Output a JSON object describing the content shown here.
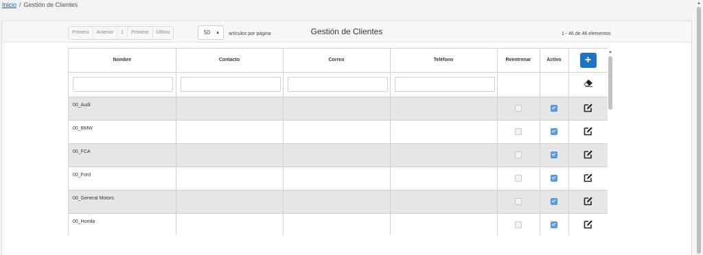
{
  "breadcrumb": {
    "home": "Inicio",
    "separator": "/",
    "current": "Gestión de Clientes"
  },
  "panel": {
    "title": "Gestión de Clientes"
  },
  "pager": {
    "first": "Primero",
    "previous": "Anterior",
    "page": "1",
    "next": "Próximo",
    "last": "Último"
  },
  "per_page": {
    "value": "50",
    "label": "artículos por página"
  },
  "range_text": "1 - 46 de 46 elementos",
  "columns": {
    "name": "Nombre",
    "contact": "Contacto",
    "email": "Correo",
    "phone": "Teléfono",
    "retrain": "Reentrenar",
    "active": "Activo",
    "add": "+"
  },
  "rows": [
    {
      "name": "00_Audi",
      "retrain": false,
      "active": true
    },
    {
      "name": "00_BMW",
      "retrain": false,
      "active": true
    },
    {
      "name": "00_FCA",
      "retrain": false,
      "active": true
    },
    {
      "name": "00_Ford",
      "retrain": false,
      "active": true
    },
    {
      "name": "00_General Motors",
      "retrain": false,
      "active": true
    },
    {
      "name": "00_Honda",
      "retrain": false,
      "active": true
    }
  ],
  "icons": {
    "add": "plus-icon",
    "clear_filters": "eraser-icon",
    "edit": "edit-icon",
    "select_caret": "updown-caret-icon"
  },
  "colors": {
    "accent": "#1d72c9",
    "checked": "#5a9ee4",
    "alt_row": "#e6e6e6"
  }
}
